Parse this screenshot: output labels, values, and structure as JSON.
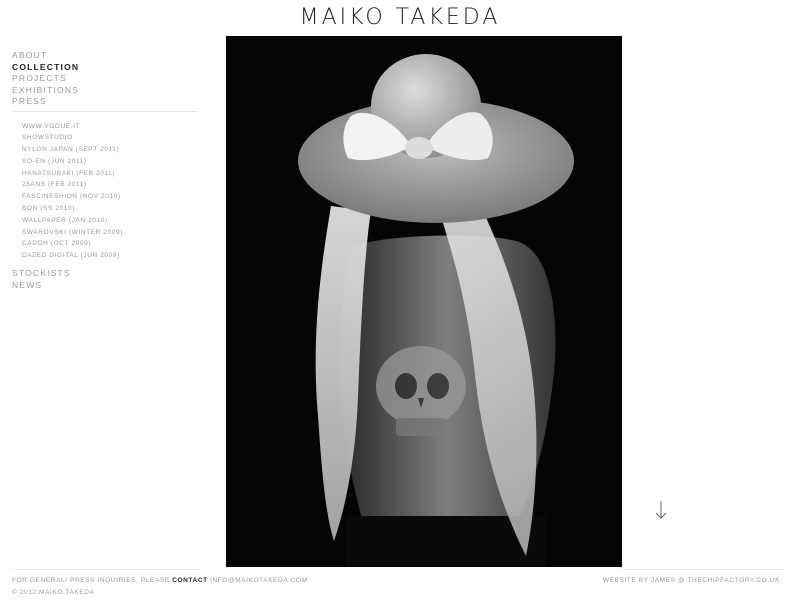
{
  "site": {
    "title": "MAIKO TAKEDA"
  },
  "nav": {
    "items": [
      {
        "label": "ABOUT",
        "active": false
      },
      {
        "label": "COLLECTION",
        "active": true
      },
      {
        "label": "PROJECTS",
        "active": false
      },
      {
        "label": "EXHIBITIONS",
        "active": false
      },
      {
        "label": "PRESS",
        "active": false
      }
    ],
    "press_items": [
      "WWW.VOGUE.IT",
      "SHOWSTUDIO",
      "NYLON JAPAN (SEPT 2011)",
      "SO-EN (JUN 2011)",
      "HANATSUBAKI (FEB 2011)",
      "25ANS (FEB 2011)",
      "FASCINESHION (NOV 2010)",
      "BON (SS 2010)",
      "WALLPAPER (JAN 2010)",
      "SWAROVSKI (WINTER 2009)",
      "CADOH (OCT 2009)",
      "DAZED DIGITAL (JUN 2009)"
    ],
    "bottom_items": [
      {
        "label": "STOCKISTS"
      },
      {
        "label": "NEWS"
      }
    ]
  },
  "footer": {
    "inquiry_text": "FOR GENERAL/ PRESS INQUIRIES, PLEASE",
    "contact_label": "CONTACT",
    "email": "INFO@MAIKOTAKEDA.COM",
    "copyright": "© 2012 MAIKO TAKEDA",
    "credit_text": "WEBSITE BY",
    "credit_name": "JAMES",
    "credit_at": "@",
    "credit_site": "THECHIPFACTORY.CO.UK"
  },
  "icons": {
    "scroll": "arrow-down-icon"
  },
  "colors": {
    "background": "#ffffff",
    "photo_bg": "#050505",
    "active_nav": "#222222",
    "muted_text": "#9a9a9a"
  }
}
